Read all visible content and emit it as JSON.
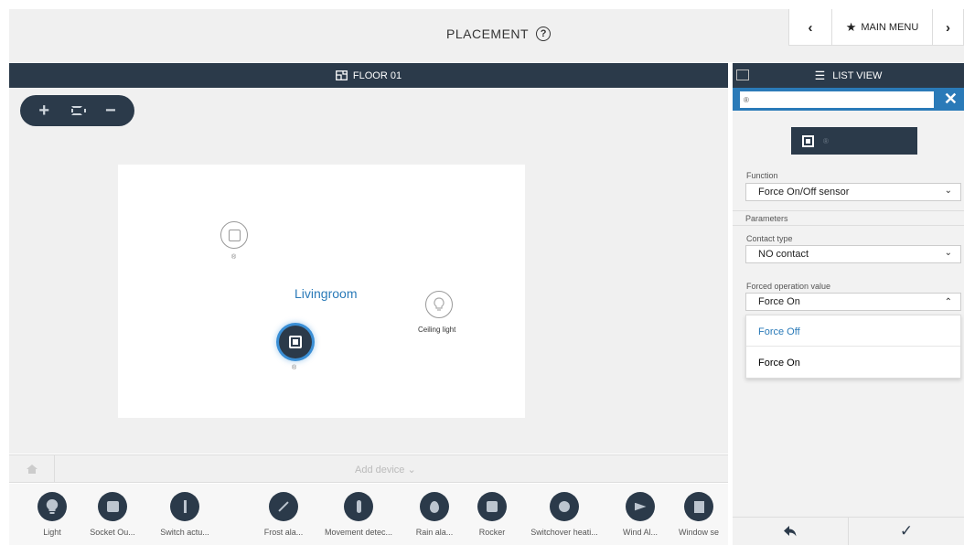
{
  "header": {
    "title": "PLACEMENT",
    "help_icon": "?",
    "prev_icon": "‹",
    "main_menu_label": "MAIN MENU",
    "next_icon": "›"
  },
  "floor": {
    "label": "FLOOR 01",
    "zoom_in": "+",
    "zoom_out": "−",
    "room_name": "Livingroom",
    "devices": {
      "rocker1_id": "®",
      "ceiling_light_label": "Ceiling light",
      "rocker2_id": "®"
    },
    "add_device_label": "Add device  ⌄"
  },
  "palette": {
    "items": [
      {
        "label": "Light",
        "icon": "bulb-icon"
      },
      {
        "label": "Socket Ou...",
        "icon": "socket-icon"
      },
      {
        "label": "Switch actu...",
        "icon": "switch-icon"
      },
      {
        "label": "Frost ala...",
        "icon": "frost-icon"
      },
      {
        "label": "Movement detec...",
        "icon": "movement-icon"
      },
      {
        "label": "Rain ala...",
        "icon": "rain-icon"
      },
      {
        "label": "Rocker",
        "icon": "rocker-icon"
      },
      {
        "label": "Switchover heati...",
        "icon": "heating-icon"
      },
      {
        "label": "Wind Al...",
        "icon": "wind-icon"
      },
      {
        "label": "Window se",
        "icon": "window-icon"
      }
    ]
  },
  "panel": {
    "list_view_label": "LIST VIEW",
    "search_value": "®",
    "close_icon": "✕",
    "device_preview_id": "®",
    "function_label": "Function",
    "function_value": "Force On/Off sensor",
    "parameters_label": "Parameters",
    "contact_type_label": "Contact type",
    "contact_type_value": "NO contact",
    "forced_value_label": "Forced operation value",
    "forced_value_value": "Force On",
    "dropdown_options": [
      "Force Off",
      "Force On"
    ],
    "back_icon": "◀",
    "confirm_icon": "✓"
  },
  "colors": {
    "dark": "#2b3a4a",
    "accent": "#2a7ab8",
    "background": "#f0f0f0"
  }
}
